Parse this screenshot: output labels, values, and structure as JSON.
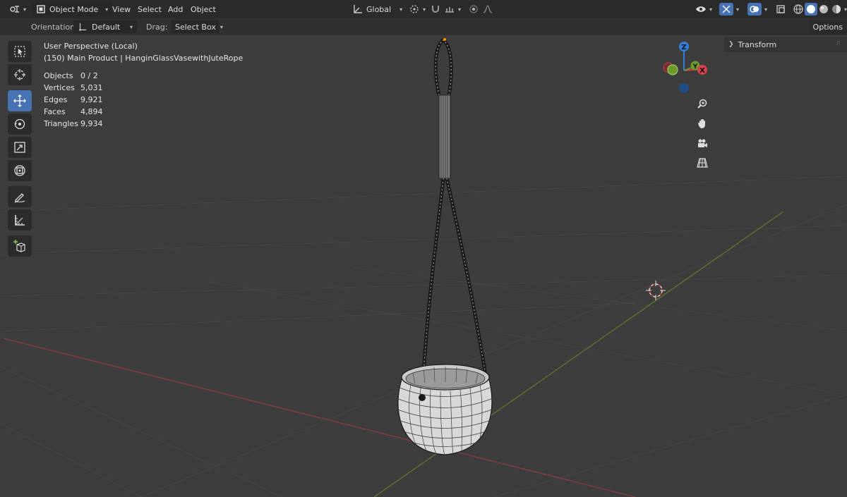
{
  "header": {
    "mode_label": "Object Mode",
    "menus": [
      "View",
      "Select",
      "Add",
      "Object"
    ],
    "transform_orientation": "Global"
  },
  "tool_header": {
    "orientation_label": "Orientation:",
    "orientation_value": "Default",
    "drag_label": "Drag:",
    "drag_value": "Select Box",
    "options_label": "Options"
  },
  "sidebar_panel": {
    "transform_label": "Transform"
  },
  "overlay": {
    "view_name": "User Perspective (Local)",
    "object_path": "(150) Main Product | HanginGlassVasewithJuteRope",
    "stats": [
      {
        "label": "Objects",
        "value": "0 / 2"
      },
      {
        "label": "Vertices",
        "value": "5,031"
      },
      {
        "label": "Edges",
        "value": "9,921"
      },
      {
        "label": "Faces",
        "value": "4,894"
      },
      {
        "label": "Triangles",
        "value": "9,934"
      }
    ]
  },
  "gizmo": {
    "z_label": "Z",
    "y_label": "Y",
    "x_label": "X"
  },
  "colors": {
    "accent": "#4772b3",
    "x_axis": "#d6404f",
    "y_axis": "#6a9b2c",
    "z_axis": "#2f7fd8",
    "header_bg": "#2b2b2b",
    "viewport_bg": "#3d3d3d"
  },
  "tools": [
    "select-box-icon",
    "cursor-icon",
    "move-icon",
    "rotate-icon",
    "scale-icon",
    "transform-icon",
    "annotate-icon",
    "measure-icon",
    "add-cube-icon"
  ]
}
